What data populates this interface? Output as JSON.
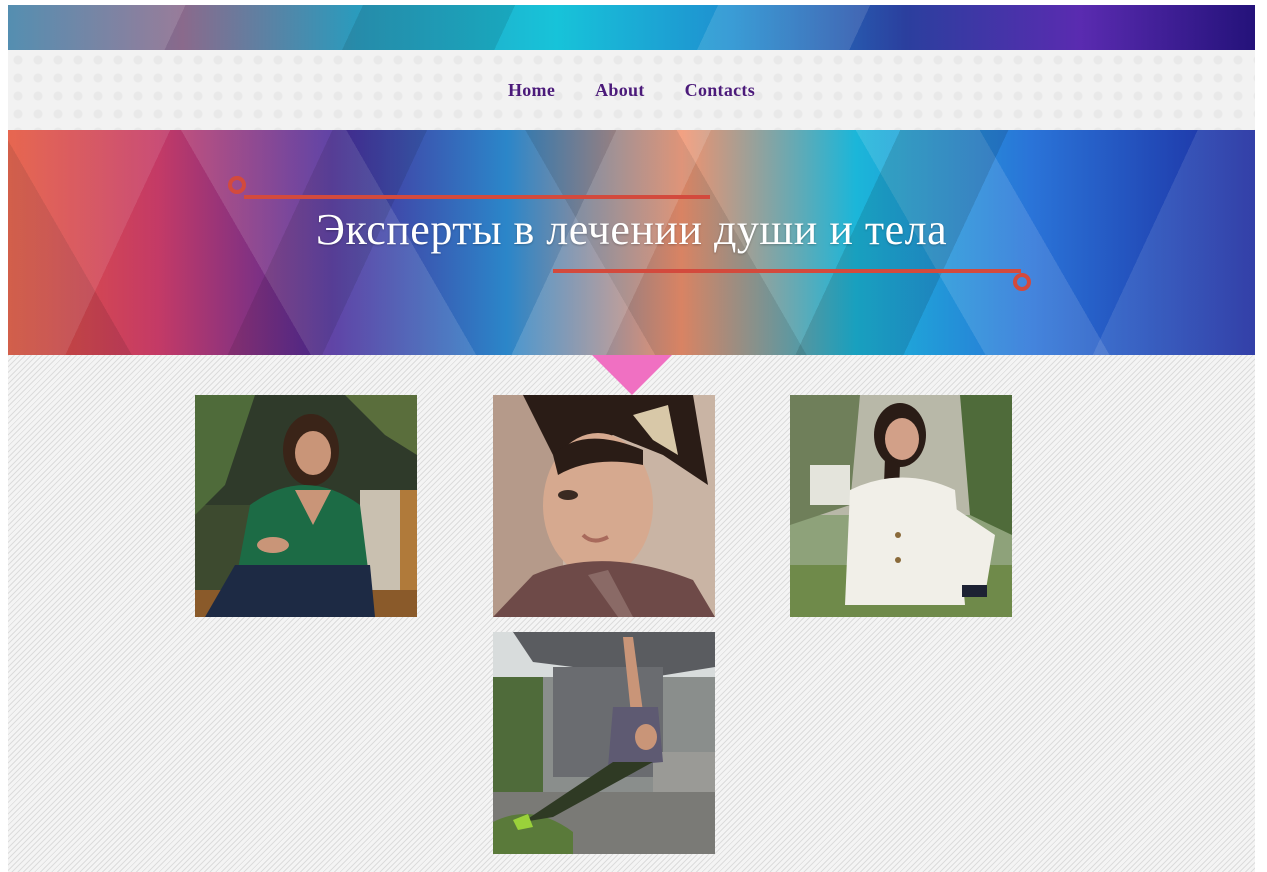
{
  "nav": {
    "items": [
      {
        "label": "Home"
      },
      {
        "label": "About"
      },
      {
        "label": "Contacts"
      }
    ],
    "link_color": "#4b1a7a"
  },
  "hero": {
    "title": "Эксперты в лечении души и тела",
    "accent_color": "#d34a3d"
  },
  "pointer_color": "#f070c2",
  "experts": [
    {
      "photo": "woman-green-sweater-photo"
    },
    {
      "photo": "woman-short-hair-closeup-photo"
    },
    {
      "photo": "woman-white-coat-photo"
    },
    {
      "photo": "man-side-plank-photo"
    }
  ]
}
